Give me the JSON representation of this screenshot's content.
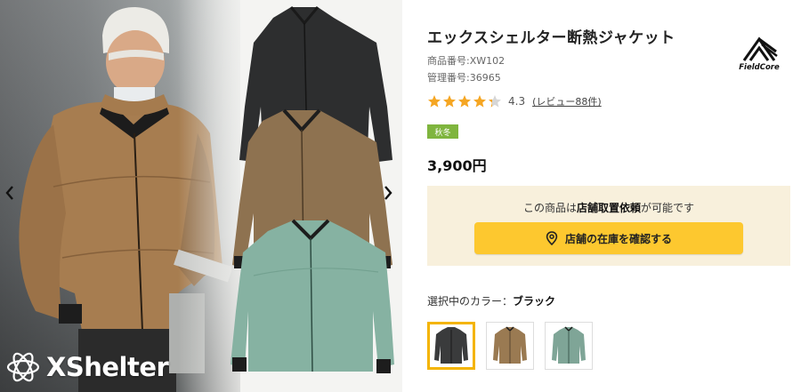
{
  "gallery": {
    "prev_icon": "chevron-left-icon",
    "next_icon": "chevron-right-icon",
    "brand_logo_text": "XShelter"
  },
  "product": {
    "title": "エックスシェルター断熱ジャケット",
    "product_code": "商品番号:XW102",
    "management_code": "管理番号:36965",
    "maker_name": "FieldCore",
    "rating": {
      "value": 4.3,
      "value_text": "4.3",
      "stars": 5,
      "review_link": "(レビュー88件)"
    },
    "season_badge": "秋冬",
    "price": "3,900円"
  },
  "store": {
    "message_before": "この商品は",
    "message_bold": "店舗取置依頼",
    "message_after": "が可能です",
    "button_label": "店舗の在庫を確認する",
    "button_icon": "map-pin-icon"
  },
  "colors": {
    "label": "選択中のカラー：",
    "selected": "ブラック",
    "options": [
      {
        "name": "black",
        "hex": "#3a3b3c"
      },
      {
        "name": "coyote",
        "hex": "#9a7a52"
      },
      {
        "name": "sage",
        "hex": "#7fa597"
      }
    ]
  },
  "theme": {
    "accent_yellow": "#fdc82f",
    "badge_green": "#7fb53e",
    "store_box_bg": "#f8f0dc",
    "star_color": "#f5a623"
  }
}
